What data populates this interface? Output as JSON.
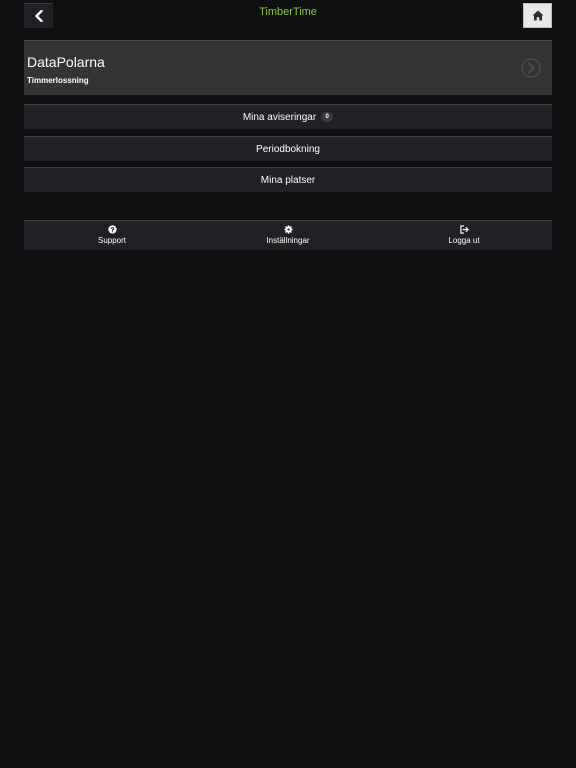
{
  "header": {
    "title": "TimberTime",
    "title_color": "#8dc63f",
    "back_icon": "chevron-left-icon",
    "home_icon": "home-icon"
  },
  "main_card": {
    "title": "DataPolarna",
    "subtitle": "Timmerlossning",
    "arrow_icon": "chevron-right-circle-icon"
  },
  "menu": {
    "notifications_label": "Mina aviseringar",
    "notifications_count": "0",
    "period_booking_label": "Periodbokning",
    "places_label": "Mina platser"
  },
  "footer": {
    "items": [
      {
        "label": "Support",
        "icon": "question-circle-icon"
      },
      {
        "label": "Inställningar",
        "icon": "gear-icon"
      },
      {
        "label": "Logga ut",
        "icon": "logout-icon"
      }
    ]
  }
}
